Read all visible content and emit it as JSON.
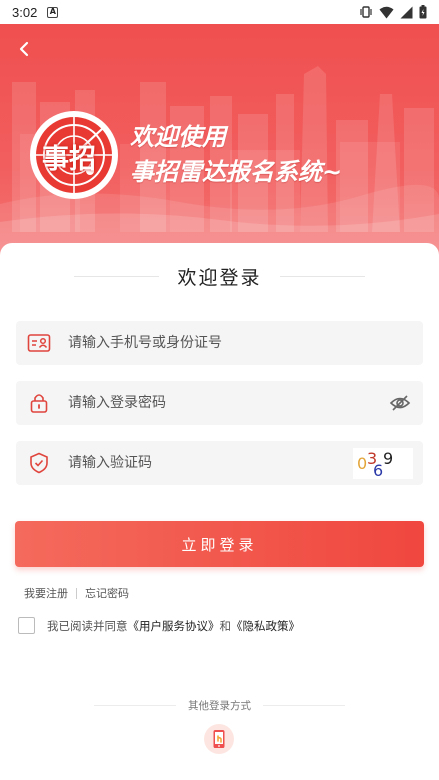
{
  "status_bar": {
    "time": "3:02",
    "notification_icon": "A"
  },
  "banner": {
    "title_line1": "欢迎使用",
    "title_line2": "事招雷达报名系统~",
    "logo_text": "事招"
  },
  "login": {
    "welcome": "欢迎登录",
    "account_placeholder": "请输入手机号或身份证号",
    "password_placeholder": "请输入登录密码",
    "captcha_placeholder": "请输入验证码",
    "captcha_chars": [
      "0",
      "3",
      "9",
      "6"
    ],
    "submit_label": "立即登录",
    "register_label": "我要注册",
    "forgot_label": "忘记密码",
    "agree_prefix": "我已阅读并同意",
    "user_agreement": "《用户服务协议》",
    "agree_and": "和",
    "privacy_policy": "《隐私政策》",
    "other_login": "其他登录方式"
  },
  "colors": {
    "brand": "#f04f4f",
    "button_start": "#f46a5c",
    "button_end": "#f0473f"
  }
}
